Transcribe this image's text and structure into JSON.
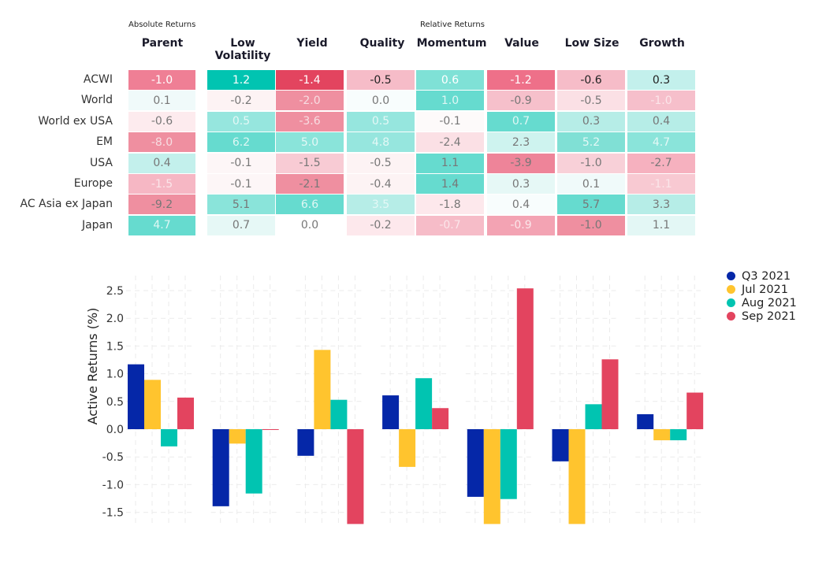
{
  "table": {
    "absolute_label": "Absolute Returns",
    "relative_label": "Relative Returns",
    "columns": [
      "Parent",
      "Low Volatility",
      "Yield",
      "Quality",
      "Momentum",
      "Value",
      "Low Size",
      "Growth"
    ],
    "rows": [
      {
        "label": "ACWI",
        "cells": [
          [
            "-1.0",
            "#ef7f95",
            "#ffffff"
          ],
          [
            "1.2",
            "#01c4b1",
            "#ffffff"
          ],
          [
            "-1.4",
            "#e3445f",
            "#ffffff"
          ],
          [
            "-0.5",
            "#f6bcc8",
            "#222222"
          ],
          [
            "0.6",
            "#7fe1d6",
            "#ffffff"
          ],
          [
            "-1.2",
            "#ee7089",
            "#ffffff"
          ],
          [
            "-0.6",
            "#f6bcc8",
            "#222222"
          ],
          [
            "0.3",
            "#c3f0ec",
            "#222222"
          ]
        ]
      },
      {
        "label": "World",
        "cells": [
          [
            "0.1",
            "#f0fafa",
            "#777777"
          ],
          [
            "-0.2",
            "#fdf3f4",
            "#777777"
          ],
          [
            "-2.0",
            "#ef8fa0",
            "#f7dde2"
          ],
          [
            "0.0",
            "#f8fdfd",
            "#777777"
          ],
          [
            "1.0",
            "#66dbcf",
            "#dff7f4"
          ],
          [
            "-0.9",
            "#f6c0cb",
            "#777777"
          ],
          [
            "-0.5",
            "#fbe0e5",
            "#777777"
          ],
          [
            "-1.0",
            "#f6bfcb",
            "#fbe6ea"
          ]
        ]
      },
      {
        "label": "World ex USA",
        "cells": [
          [
            "-0.6",
            "#fdebee",
            "#777777"
          ],
          [
            "0.5",
            "#96e6de",
            "#e4f8f6"
          ],
          [
            "-3.6",
            "#ef8fa0",
            "#f7dde2"
          ],
          [
            "0.5",
            "#96e6de",
            "#e4f8f6"
          ],
          [
            "-0.1",
            "#fdfafa",
            "#777777"
          ],
          [
            "0.7",
            "#66dbcf",
            "#dff7f4"
          ],
          [
            "0.3",
            "#b6ede7",
            "#777777"
          ],
          [
            "0.4",
            "#b6ede7",
            "#777777"
          ]
        ]
      },
      {
        "label": "EM",
        "cells": [
          [
            "-8.0",
            "#ef8fa0",
            "#f7dde2"
          ],
          [
            "6.2",
            "#66dbcf",
            "#dff7f4"
          ],
          [
            "5.0",
            "#8ae4da",
            "#e4f8f6"
          ],
          [
            "4.8",
            "#96e6de",
            "#e4f8f6"
          ],
          [
            "-2.4",
            "#fbe0e5",
            "#777777"
          ],
          [
            "2.3",
            "#cef3ef",
            "#777777"
          ],
          [
            "5.2",
            "#80e0d5",
            "#e4f8f6"
          ],
          [
            "4.7",
            "#8ae4da",
            "#e4f8f6"
          ]
        ]
      },
      {
        "label": "USA",
        "cells": [
          [
            "0.4",
            "#c3f0ec",
            "#777777"
          ],
          [
            "-0.1",
            "#fdf6f7",
            "#777777"
          ],
          [
            "-1.5",
            "#f8cbd4",
            "#777777"
          ],
          [
            "-0.5",
            "#fdf3f4",
            "#777777"
          ],
          [
            "1.1",
            "#66dbcf",
            "#777777"
          ],
          [
            "-3.9",
            "#ee8499",
            "#777777"
          ],
          [
            "-1.0",
            "#f8d0d8",
            "#777777"
          ],
          [
            "-2.7",
            "#f6b1bf",
            "#777777"
          ]
        ]
      },
      {
        "label": "Europe",
        "cells": [
          [
            "-1.5",
            "#f6b7c4",
            "#fbe6ea"
          ],
          [
            "-0.1",
            "#fdf6f7",
            "#777777"
          ],
          [
            "-2.1",
            "#ef8fa0",
            "#777777"
          ],
          [
            "-0.4",
            "#fdf3f4",
            "#777777"
          ],
          [
            "1.4",
            "#66dbcf",
            "#777777"
          ],
          [
            "0.3",
            "#e6f8f6",
            "#777777"
          ],
          [
            "0.1",
            "#f0fafa",
            "#777777"
          ],
          [
            "-1.1",
            "#f8c9d2",
            "#fbe6ea"
          ]
        ]
      },
      {
        "label": "AC Asia ex Japan",
        "cells": [
          [
            "-9.2",
            "#ef8fa0",
            "#777777"
          ],
          [
            "5.1",
            "#8ae4da",
            "#777777"
          ],
          [
            "6.6",
            "#66dbcf",
            "#dff7f4"
          ],
          [
            "3.5",
            "#b6ede7",
            "#e4f8f6"
          ],
          [
            "-1.8",
            "#fde8ec",
            "#777777"
          ],
          [
            "0.4",
            "#f8fdfd",
            "#777777"
          ],
          [
            "5.7",
            "#66dbcf",
            "#777777"
          ],
          [
            "3.3",
            "#b6ede7",
            "#777777"
          ]
        ]
      },
      {
        "label": "Japan",
        "cells": [
          [
            "4.7",
            "#66dbcf",
            "#dff7f4"
          ],
          [
            "0.7",
            "#e6f8f6",
            "#777777"
          ],
          [
            "0.0",
            "#ffffff",
            "#777777"
          ],
          [
            "-0.2",
            "#fde8ec",
            "#777777"
          ],
          [
            "-0.7",
            "#f6bcc8",
            "#fbe6ea"
          ],
          [
            "-0.9",
            "#f3a3b3",
            "#fbe6ea"
          ],
          [
            "-1.0",
            "#ef8fa0",
            "#777777"
          ],
          [
            "1.1",
            "#e3f7f5",
            "#777777"
          ]
        ]
      }
    ]
  },
  "chart_data": {
    "type": "bar",
    "categories": [
      "Parent",
      "Low Volatility",
      "Yield",
      "Quality",
      "Value",
      "Low Size",
      "Growth"
    ],
    "ylabel": "Active Returns (%)",
    "xlabel": "",
    "ylim": [
      -1.7,
      2.75
    ],
    "yticks": [
      "-1.5",
      "-1.0",
      "-0.5",
      "0.0",
      "0.5",
      "1.0",
      "1.5",
      "2.0",
      "2.5"
    ],
    "grid": true,
    "legend_position": "top-right",
    "series": [
      {
        "name": "Q3 2021",
        "color": "#0527a8",
        "values": [
          1.17,
          -1.39,
          -0.48,
          0.61,
          -1.22,
          -0.58,
          0.27
        ]
      },
      {
        "name": "Jul 2021",
        "color": "#ffc42e",
        "values": [
          0.89,
          -0.26,
          1.43,
          -0.68,
          -1.71,
          -1.71,
          -0.2
        ]
      },
      {
        "name": "Aug 2021",
        "color": "#01c4b1",
        "values": [
          -0.31,
          -1.16,
          0.53,
          0.92,
          -1.26,
          0.45,
          -0.2
        ]
      },
      {
        "name": "Sep 2021",
        "color": "#e3445f",
        "values": [
          0.57,
          -0.01,
          -1.71,
          0.38,
          2.54,
          1.26,
          0.66
        ]
      }
    ]
  }
}
